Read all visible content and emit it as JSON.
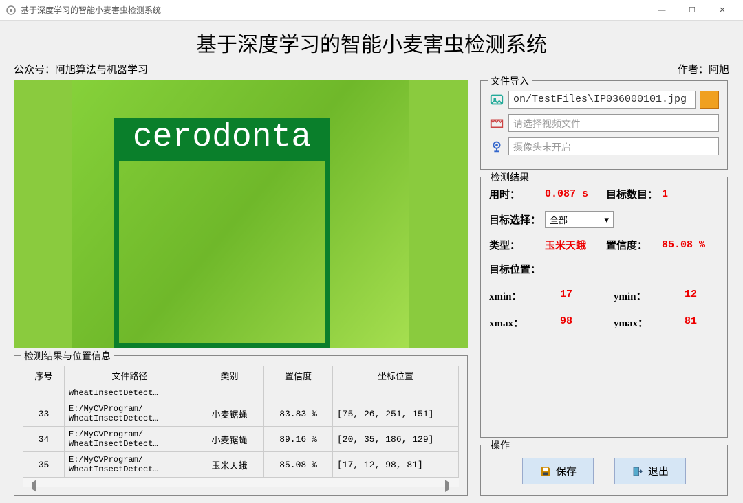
{
  "window": {
    "title": "基于深度学习的智能小麦害虫检测系统"
  },
  "header": {
    "main_title": "基于深度学习的智能小麦害虫检测系统",
    "left_sub": "公众号：阿旭算法与机器学习",
    "right_sub": "作者：阿旭"
  },
  "detection": {
    "bbox_label": "cerodonta"
  },
  "file_import": {
    "legend": "文件导入",
    "image_path": "on/TestFiles\\IP036000101.jpg",
    "video_placeholder": "请选择视频文件",
    "camera_placeholder": "摄像头未开启"
  },
  "results": {
    "legend": "检测结果",
    "time_label": "用时：",
    "time_value": "0.087 s",
    "count_label": "目标数目：",
    "count_value": "1",
    "target_select_label": "目标选择：",
    "target_select_value": "全部",
    "type_label": "类型：",
    "type_value": "玉米天蛾",
    "conf_label": "置信度：",
    "conf_value": "85.08 %",
    "pos_label": "目标位置：",
    "xmin_l": "xmin：",
    "xmin_v": "17",
    "ymin_l": "ymin：",
    "ymin_v": "12",
    "xmax_l": "xmax：",
    "xmax_v": "98",
    "ymax_l": "ymax：",
    "ymax_v": "81"
  },
  "actions": {
    "legend": "操作",
    "save": "保存",
    "exit": "退出"
  },
  "table": {
    "legend": "检测结果与位置信息",
    "headers": [
      "序号",
      "文件路径",
      "类别",
      "置信度",
      "坐标位置"
    ],
    "rows": [
      {
        "idx": "",
        "path": "WheatInsectDetect…",
        "cls": "",
        "conf": "",
        "coord": ""
      },
      {
        "idx": "33",
        "path": "E:/MyCVProgram/\nWheatInsectDetect…",
        "cls": "小麦锯蝇",
        "conf": "83.83 %",
        "coord": "[75, 26, 251, 151]"
      },
      {
        "idx": "34",
        "path": "E:/MyCVProgram/\nWheatInsectDetect…",
        "cls": "小麦锯蝇",
        "conf": "89.16 %",
        "coord": "[20, 35, 186, 129]"
      },
      {
        "idx": "35",
        "path": "E:/MyCVProgram/\nWheatInsectDetect…",
        "cls": "玉米天蛾",
        "conf": "85.08 %",
        "coord": "[17, 12, 98, 81]"
      }
    ]
  }
}
